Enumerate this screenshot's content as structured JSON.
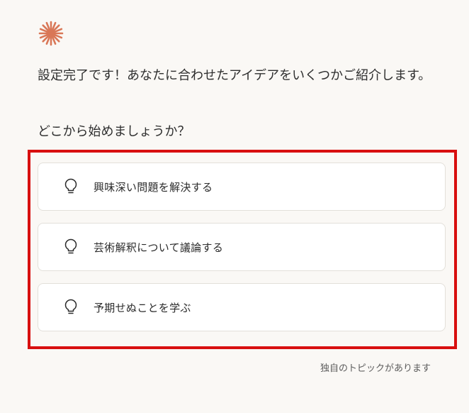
{
  "logo": {
    "icon": "asterisk-logo-icon",
    "color": "#d97757"
  },
  "intro": {
    "message": "設定完了です！あなたに合わせたアイデアをいくつかご紹介します。",
    "question": "どこから始めましょうか？"
  },
  "options": [
    {
      "icon": "lightbulb-icon",
      "label": "興味深い問題を解決する"
    },
    {
      "icon": "lightbulb-icon",
      "label": "芸術解釈について議論する"
    },
    {
      "icon": "lightbulb-icon",
      "label": "予期せぬことを学ぶ"
    }
  ],
  "footer": {
    "own_topic_label": "独自のトピックがあります"
  },
  "colors": {
    "background": "#faf8f5",
    "highlight": "#d80f0f",
    "card": "#ffffff"
  }
}
